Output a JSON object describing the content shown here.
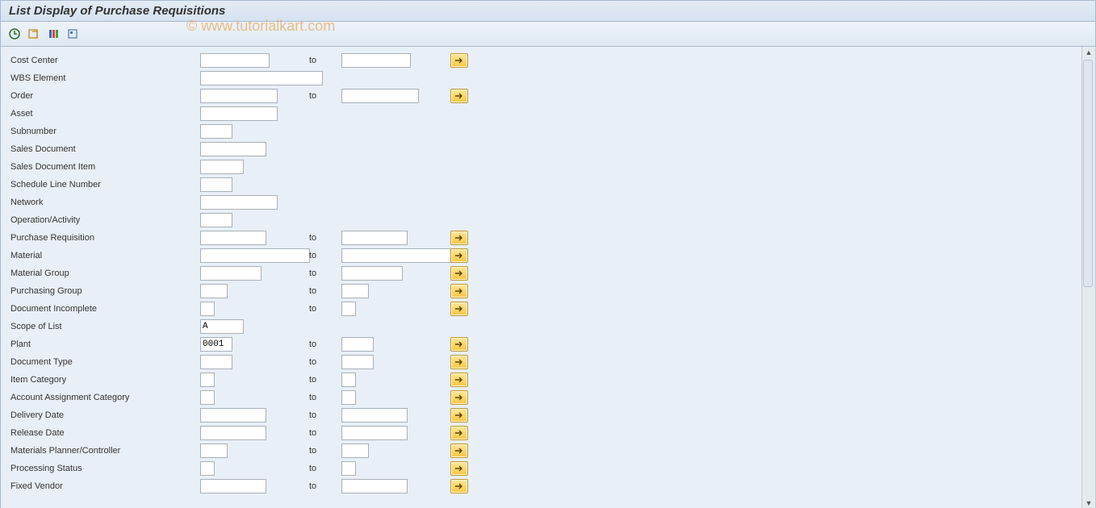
{
  "title": "List Display of Purchase Requisitions",
  "watermark": "© www.tutorialkart.com",
  "labels": {
    "to": "to"
  },
  "fields": [
    {
      "name": "cost_center",
      "label": "Cost Center",
      "from": "",
      "fw": 80,
      "has_to": true,
      "to_val": "",
      "tw": 80,
      "more": true
    },
    {
      "name": "wbs_element",
      "label": "WBS Element",
      "from": "",
      "fw": 168,
      "has_to": false,
      "more": false
    },
    {
      "name": "order",
      "label": "Order",
      "from": "",
      "fw": 90,
      "has_to": true,
      "to_val": "",
      "tw": 90,
      "more": true
    },
    {
      "name": "asset",
      "label": "Asset",
      "from": "",
      "fw": 90,
      "has_to": false,
      "more": false
    },
    {
      "name": "subnumber",
      "label": "Subnumber",
      "from": "",
      "fw": 34,
      "has_to": false,
      "more": false
    },
    {
      "name": "sales_doc",
      "label": "Sales Document",
      "from": "",
      "fw": 76,
      "has_to": false,
      "more": false
    },
    {
      "name": "sales_doc_item",
      "label": "Sales Document Item",
      "from": "",
      "fw": 48,
      "has_to": false,
      "more": false
    },
    {
      "name": "sched_line",
      "label": "Schedule Line Number",
      "from": "",
      "fw": 34,
      "has_to": false,
      "more": false
    },
    {
      "name": "network",
      "label": "Network",
      "from": "",
      "fw": 90,
      "has_to": false,
      "more": false
    },
    {
      "name": "op_activity",
      "label": "Operation/Activity",
      "from": "",
      "fw": 34,
      "has_to": false,
      "more": false
    },
    {
      "name": "purch_req",
      "label": "Purchase Requisition",
      "from": "",
      "fw": 76,
      "has_to": true,
      "to_val": "",
      "tw": 76,
      "more": true
    },
    {
      "name": "material",
      "label": "Material",
      "from": "",
      "fw": 130,
      "has_to": true,
      "to_val": "",
      "tw": 130,
      "more": true
    },
    {
      "name": "mat_group",
      "label": "Material Group",
      "from": "",
      "fw": 70,
      "has_to": true,
      "to_val": "",
      "tw": 70,
      "more": true
    },
    {
      "name": "purch_group",
      "label": "Purchasing Group",
      "from": "",
      "fw": 28,
      "has_to": true,
      "to_val": "",
      "tw": 28,
      "more": true
    },
    {
      "name": "doc_incomplete",
      "label": "Document Incomplete",
      "from": "",
      "fw": 12,
      "has_to": true,
      "to_val": "",
      "tw": 12,
      "more": true
    },
    {
      "name": "scope_list",
      "label": "Scope of List",
      "from": "A",
      "fw": 48,
      "has_to": false,
      "more": false
    },
    {
      "name": "plant",
      "label": "Plant",
      "from": "0001",
      "fw": 34,
      "has_to": true,
      "to_val": "",
      "tw": 34,
      "more": true
    },
    {
      "name": "doc_type",
      "label": "Document Type",
      "from": "",
      "fw": 34,
      "has_to": true,
      "to_val": "",
      "tw": 34,
      "more": true
    },
    {
      "name": "item_cat",
      "label": "Item Category",
      "from": "",
      "fw": 12,
      "has_to": true,
      "to_val": "",
      "tw": 12,
      "more": true
    },
    {
      "name": "acct_assign",
      "label": "Account Assignment Category",
      "from": "",
      "fw": 12,
      "has_to": true,
      "to_val": "",
      "tw": 12,
      "more": true
    },
    {
      "name": "delivery_date",
      "label": "Delivery Date",
      "from": "",
      "fw": 76,
      "has_to": true,
      "to_val": "",
      "tw": 76,
      "more": true
    },
    {
      "name": "release_date",
      "label": "Release Date",
      "from": "",
      "fw": 76,
      "has_to": true,
      "to_val": "",
      "tw": 76,
      "more": true
    },
    {
      "name": "mrp_controller",
      "label": "Materials Planner/Controller",
      "from": "",
      "fw": 28,
      "has_to": true,
      "to_val": "",
      "tw": 28,
      "more": true
    },
    {
      "name": "proc_status",
      "label": "Processing Status",
      "from": "",
      "fw": 12,
      "has_to": true,
      "to_val": "",
      "tw": 12,
      "more": true
    },
    {
      "name": "fixed_vendor",
      "label": "Fixed Vendor",
      "from": "",
      "fw": 76,
      "has_to": true,
      "to_val": "",
      "tw": 76,
      "more": true
    }
  ]
}
